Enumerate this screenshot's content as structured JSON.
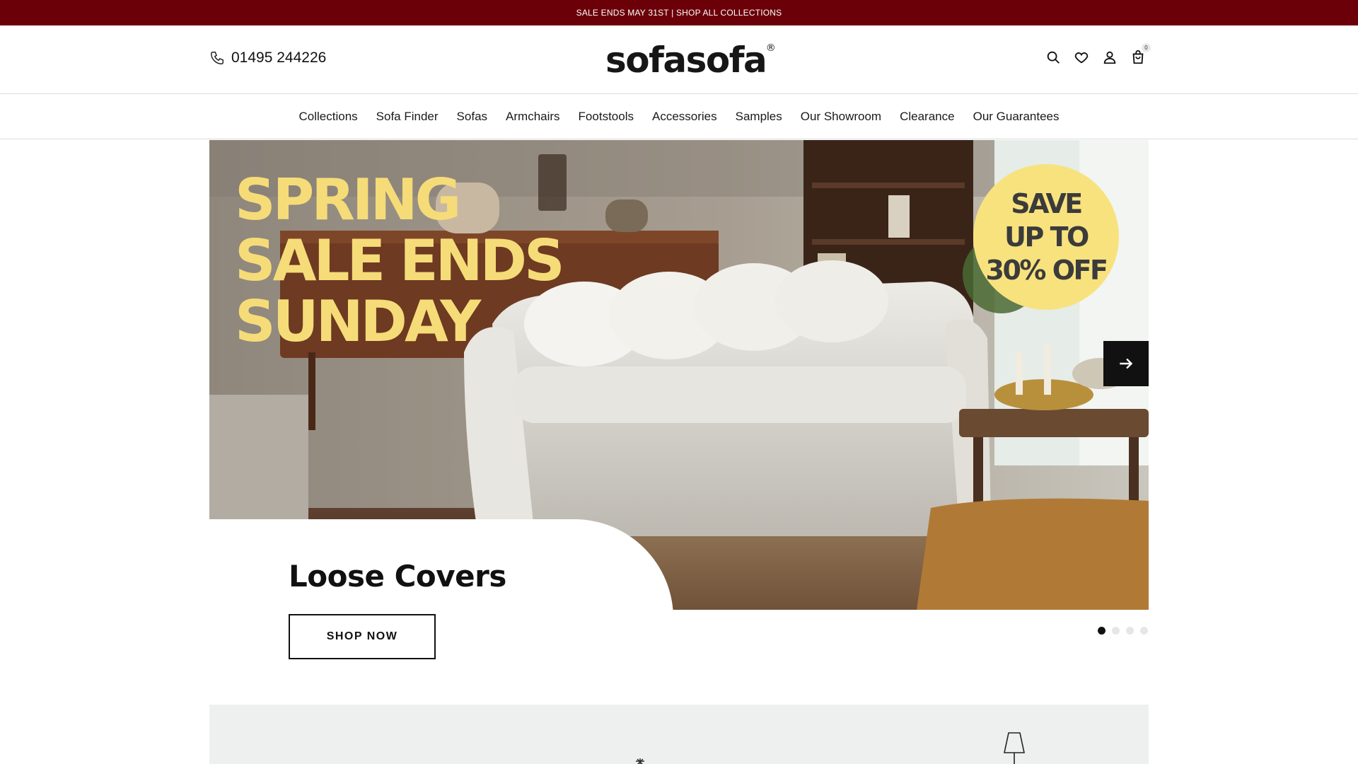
{
  "announcement": {
    "text": "SALE ENDS MAY 31ST | SHOP ALL COLLECTIONS"
  },
  "header": {
    "phone": "01495 244226",
    "logo": "sofasofa",
    "logo_mark": "®",
    "icons": [
      "search-icon",
      "heart-icon",
      "user-icon",
      "bag-icon"
    ],
    "cart_count": "0"
  },
  "nav": {
    "items": [
      "Collections",
      "Sofa Finder",
      "Sofas",
      "Armchairs",
      "Footstools",
      "Accessories",
      "Samples",
      "Our Showroom",
      "Clearance",
      "Our Guarantees"
    ]
  },
  "hero": {
    "headline": [
      "SPRING",
      "SALE ENDS",
      "SUNDAY"
    ],
    "badge": [
      "SAVE",
      "UP TO",
      "30% OFF"
    ],
    "slide_title": "Loose Covers",
    "cta": "SHOP NOW",
    "slide_count": 4,
    "active_slide": 1,
    "colors": {
      "headline": "#f6dc78",
      "badge": "#f8e27e",
      "announcement_bg": "#6b0008"
    }
  }
}
